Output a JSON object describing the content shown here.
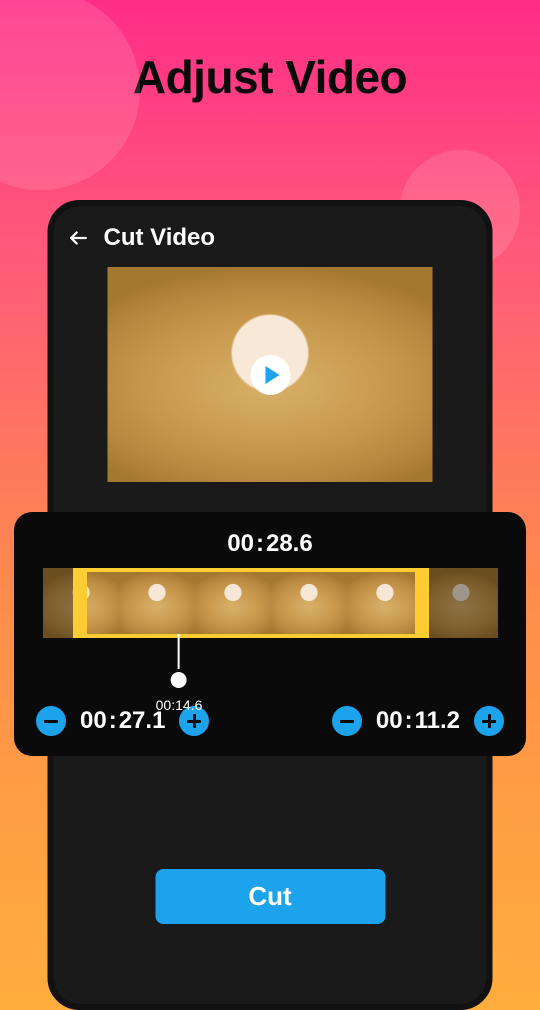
{
  "promo": {
    "title": "Adjust Video"
  },
  "header": {
    "title": "Cut Video"
  },
  "trim": {
    "total_mm": "00",
    "total_ss": "28.6",
    "playhead": "00:14.6",
    "start_mm": "00",
    "start_ss": "27.1",
    "end_mm": "00",
    "end_ss": "11.2"
  },
  "actions": {
    "cut": "Cut"
  }
}
